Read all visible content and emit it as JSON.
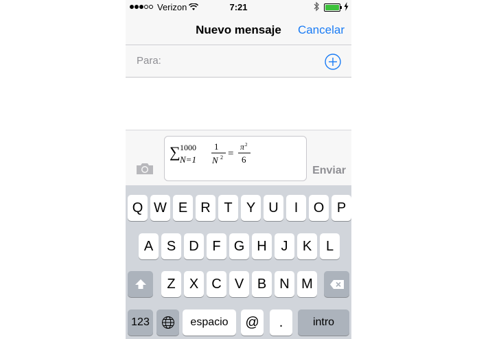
{
  "status_bar": {
    "carrier": "Verizon",
    "time": "7:21",
    "signal_bars_filled": 3,
    "signal_bars_total": 5,
    "battery_level": 1.0,
    "icons": [
      "wifi-icon",
      "bluetooth-icon",
      "battery-icon",
      "charging-bolt-icon"
    ]
  },
  "nav": {
    "title": "Nuevo mensaje",
    "cancel_label": "Cancelar"
  },
  "recipients": {
    "label": "Para:",
    "value": "",
    "add_icon": "plus-circle-icon"
  },
  "compose": {
    "camera_icon": "camera-icon",
    "message_formula": "∑_{N=1}^{1000} 1/N² = π²/6",
    "formula_parts": {
      "sum_symbol": "∑",
      "upper_limit": "1000",
      "lower_limit": "N=1",
      "numerator": "1",
      "denominator": "N",
      "denominator_exponent": "2",
      "equals": "=",
      "rhs_numerator": "π",
      "rhs_numerator_exponent": "2",
      "rhs_denominator": "6"
    },
    "send_label": "Enviar"
  },
  "keyboard": {
    "row1": [
      "Q",
      "W",
      "E",
      "R",
      "T",
      "Y",
      "U",
      "I",
      "O",
      "P"
    ],
    "row2": [
      "A",
      "S",
      "D",
      "F",
      "G",
      "H",
      "J",
      "K",
      "L"
    ],
    "row3": [
      "Z",
      "X",
      "C",
      "V",
      "B",
      "N",
      "M"
    ],
    "shift_icon": "shift-icon",
    "delete_icon": "backspace-icon",
    "numbers_label": "123",
    "globe_icon": "globe-icon",
    "space_label": "espacio",
    "at_label": "@",
    "dot_label": ".",
    "return_label": "intro"
  },
  "colors": {
    "accent": "#1a7cf5",
    "battery": "#3cc13b",
    "disabled_text": "#8e8e93",
    "keyboard_bg": "#d1d5db"
  }
}
